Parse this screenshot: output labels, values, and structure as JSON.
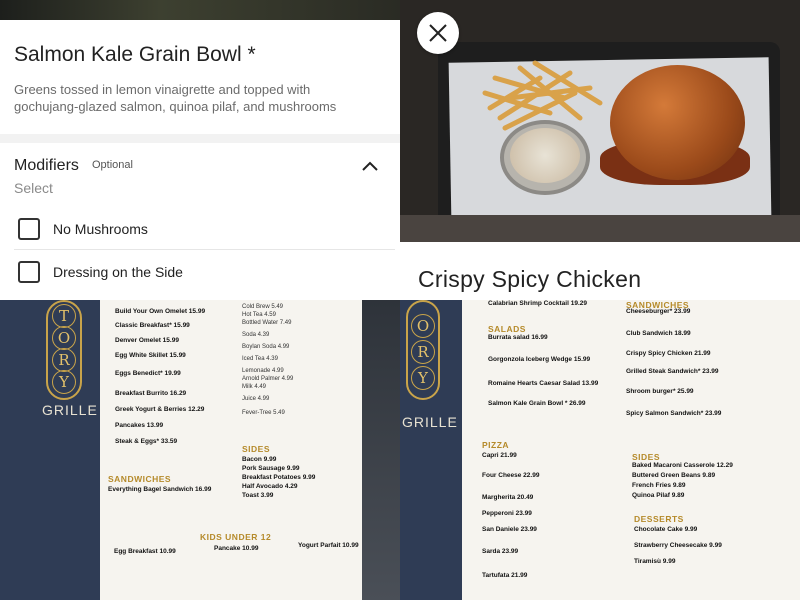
{
  "item_modal": {
    "title": "Salmon Kale Grain Bowl *",
    "description": "Greens tossed in lemon vinaigrette and topped with gochujang-glazed salmon, quinoa pilaf, and mushrooms",
    "modifiers": {
      "heading": "Modifiers",
      "badge": "Optional",
      "subheading": "Select",
      "options": [
        {
          "label": "No Mushrooms",
          "checked": false
        },
        {
          "label": "Dressing on the Side",
          "checked": false
        }
      ]
    }
  },
  "photo_view": {
    "item_name": "Crispy Spicy Chicken"
  },
  "menu_left": {
    "brand_letters": [
      "T",
      "O",
      "R",
      "Y"
    ],
    "brand_word": "GRILLE",
    "breakfast_items": [
      "Build Your Own Omelet 15.99",
      "Classic Breakfast* 15.99",
      "Denver Omelet 15.99",
      "Egg White Skillet 15.99",
      "Eggs Benedict* 19.99",
      "Breakfast Burrito 16.29",
      "Greek Yogurt & Berries 12.29",
      "Pancakes 13.99",
      "Steak & Eggs* 33.59"
    ],
    "drinks": [
      "Cold Brew 5.49",
      "Hot Tea 4.59",
      "Bottled Water 7.49",
      "Soda 4.39",
      "Boylan Soda 4.99",
      "Iced Tea 4.39",
      "Lemonade 4.99",
      "Arnold Palmer 4.99",
      "Milk 4.49",
      "Juice 4.99",
      "Fever-Tree 5.49"
    ],
    "sandwiches_heading": "SANDWICHES",
    "sandwiches": [
      "Everything Bagel Sandwich 16.99"
    ],
    "sides_heading": "SIDES",
    "sides": [
      "Bacon 9.99",
      "Pork Sausage 9.99",
      "Breakfast Potatoes 9.99",
      "Half Avocado 4.29",
      "Toast 3.99"
    ],
    "kids_heading": "KIDS UNDER 12",
    "kids": [
      "Egg Breakfast 10.99",
      "Pancake 10.99",
      "Yogurt Parfait 10.99"
    ]
  },
  "menu_right": {
    "brand_letters": [
      "O",
      "R",
      "Y"
    ],
    "brand_word": "GRILLE",
    "top_item": "Calabrian Shrimp Cocktail 19.29",
    "salads_heading": "SALADS",
    "salads": [
      "Burrata salad 16.99",
      "Gorgonzola Iceberg Wedge 15.99",
      "Romaine Hearts Caesar Salad 13.99",
      "Salmon Kale Grain Bowl * 26.99"
    ],
    "pizza_heading": "PIZZA",
    "pizza": [
      "Capri 21.99",
      "Four Cheese 22.99",
      "Margherita 20.49",
      "Pepperoni 23.99",
      "San Daniele 23.99",
      "Sarda 23.99",
      "Tartufata 21.99"
    ],
    "sandwiches_heading": "SANDWICHES",
    "sandwiches": [
      "Cheeseburger* 23.99",
      "Club Sandwich 18.99",
      "Crispy Spicy Chicken 21.99",
      "Grilled Steak Sandwich* 23.99",
      "Shroom burger* 25.99",
      "Spicy Salmon Sandwich* 23.99"
    ],
    "sides_heading": "SIDES",
    "sides": [
      "Baked Macaroni Casserole 12.29",
      "Buttered Green Beans 9.89",
      "French Fries 9.89",
      "Quinoa Pilaf 9.89"
    ],
    "desserts_heading": "DESSERTS",
    "desserts": [
      "Chocolate Cake 9.99",
      "Strawberry Cheesecake 9.99",
      "Tiramisù 9.99"
    ]
  },
  "colors": {
    "menu_gold": "#b58a2a",
    "menu_navy": "#2f3c55"
  }
}
